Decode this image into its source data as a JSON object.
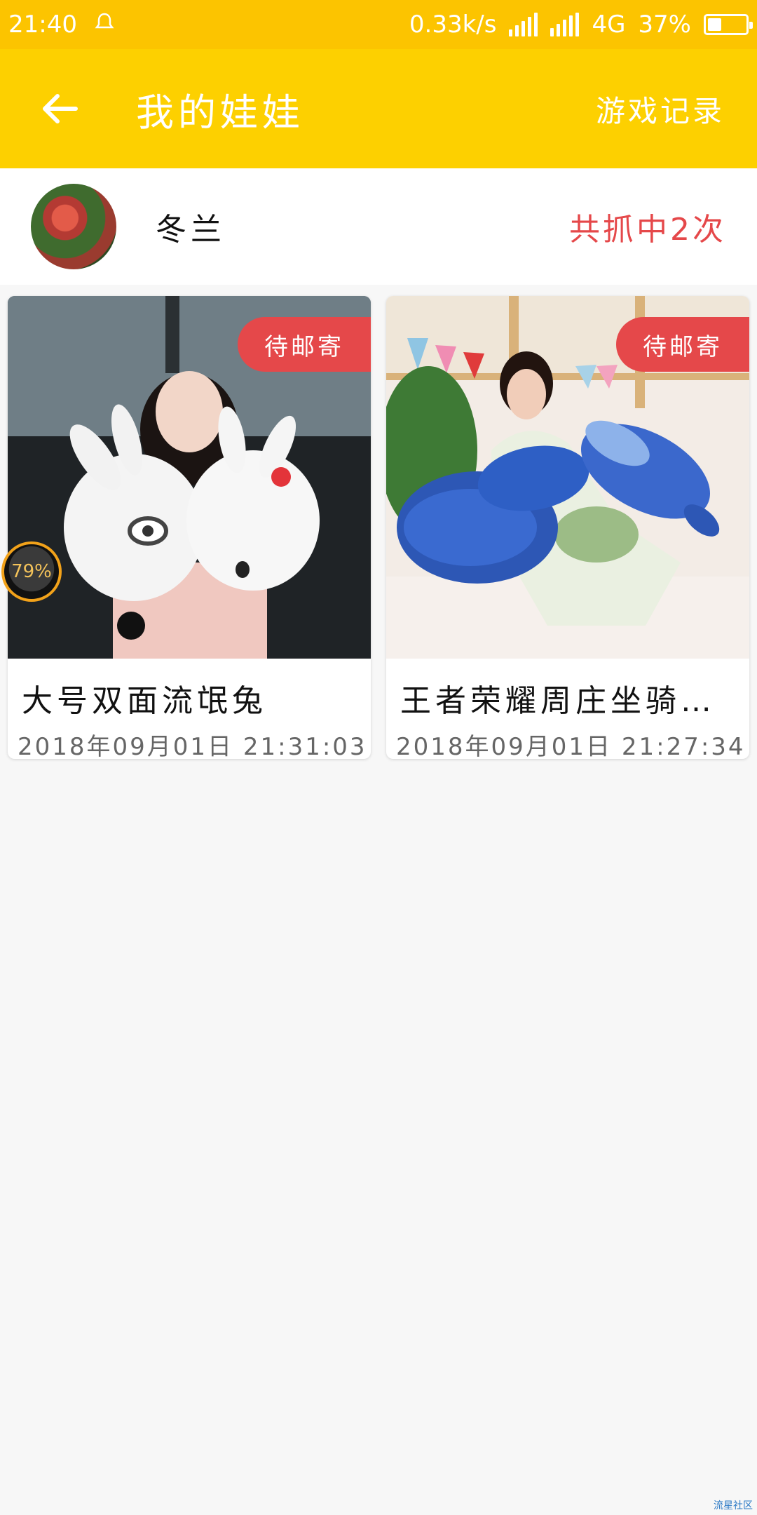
{
  "status_bar": {
    "time": "21:40",
    "network_speed": "0.33k/s",
    "network_type": "4G",
    "battery_percent": "37%",
    "battery_level": 0.37
  },
  "header": {
    "back_icon": "arrow-left-icon",
    "title": "我的娃娃",
    "action_label": "游戏记录",
    "background": "#fdd000"
  },
  "user": {
    "name": "冬兰",
    "catch_summary": "共抓中2次",
    "accent_color": "#e5484a"
  },
  "dolls": [
    {
      "title": "大号双面流氓兔",
      "date": "2018年09月01日 21:31:03",
      "status": "待邮寄"
    },
    {
      "title": "王者荣耀周庄坐骑…",
      "date": "2018年09月01日 21:27:34",
      "status": "待邮寄"
    }
  ],
  "floating_widget": {
    "label": "79%"
  },
  "watermark": "流星社区"
}
